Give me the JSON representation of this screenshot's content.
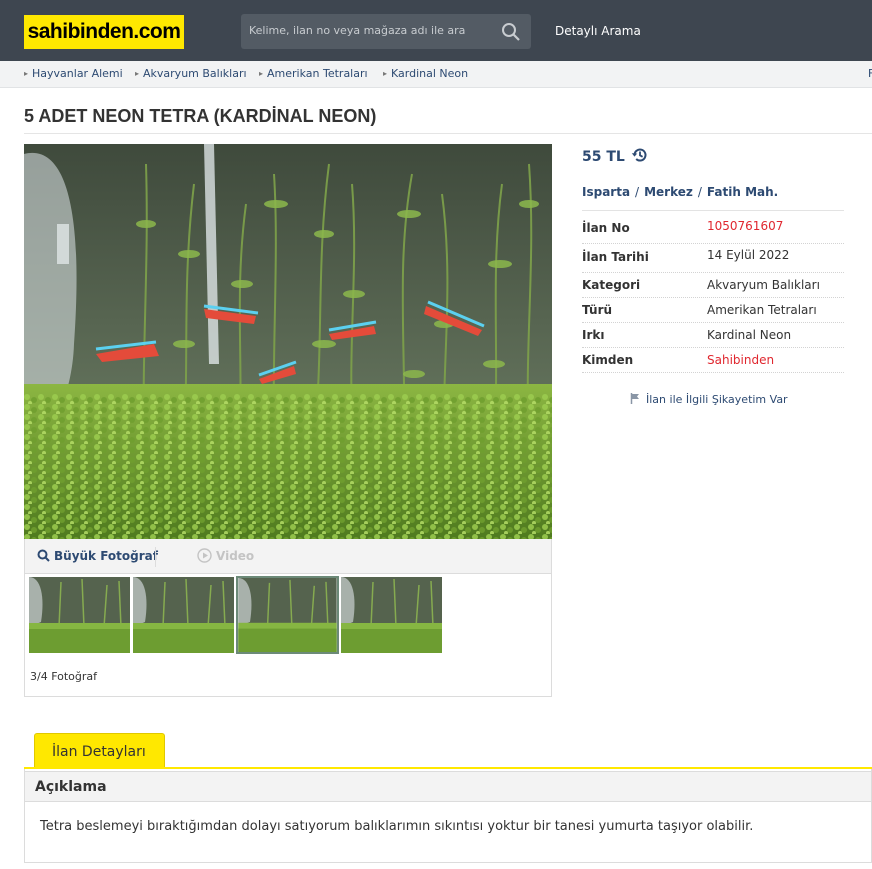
{
  "header": {
    "logo": "sahibinden.com",
    "search_placeholder": "Kelime, ilan no veya mağaza adı ile ara",
    "advanced_search": "Detaylı Arama"
  },
  "breadcrumb": [
    "Hayvanlar Alemi",
    "Akvaryum Balıkları",
    "Amerikan Tetraları",
    "Kardinal Neon"
  ],
  "breadcrumb_end": "F",
  "listing": {
    "title": "5 ADET NEON TETRA (KARDİNAL NEON)",
    "price": "55 TL",
    "location": [
      "Isparta",
      "Merkez",
      "Fatih Mah."
    ],
    "details": [
      {
        "label": "İlan No",
        "value": "1050761607",
        "highlight": true
      },
      {
        "label": "İlan Tarihi",
        "value": "14 Eylül 2022",
        "highlight": false
      },
      {
        "label": "Kategori",
        "value": "Akvaryum Balıkları",
        "highlight": false
      },
      {
        "label": "Türü",
        "value": "Amerikan Tetraları",
        "highlight": false
      },
      {
        "label": "Irkı",
        "value": "Kardinal Neon",
        "highlight": false
      },
      {
        "label": "Kimden",
        "value": "Sahibinden",
        "highlight": true
      }
    ],
    "complaint_link": "İlan ile İlgili Şikayetim Var"
  },
  "gallery": {
    "big_photo_label": "Büyük Fotoğraf",
    "video_label": "Video",
    "photo_count": "3/4 Fotoğraf",
    "active_thumb": 3,
    "thumb_count": 4
  },
  "tabs": {
    "details_tab": "İlan Detayları"
  },
  "description": {
    "heading": "Açıklama",
    "text": "Tetra beslemeyi bıraktığımdan dolayı satıyorum balıklarımın sıkıntısı yoktur bir tanesi yumurta taşıyor olabilir."
  },
  "colors": {
    "brand_yellow": "#ffe800",
    "header_bg": "#3e4650",
    "link_blue": "#2d4a72",
    "accent_red": "#e0272f"
  }
}
